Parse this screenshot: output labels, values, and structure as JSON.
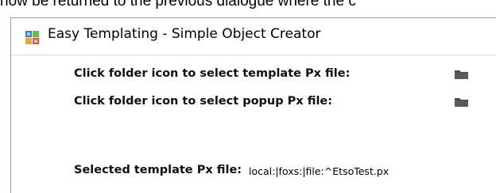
{
  "snippet": {
    "text": "now be returned to the previous dialogue where the c"
  },
  "window": {
    "title": "Easy Templating - Simple Object Creator"
  },
  "form": {
    "template_prompt": "Click folder icon to select template Px file:",
    "popup_prompt": "Click folder icon to select popup Px file:",
    "selected_label": "Selected template Px file:",
    "selected_value": "local:|foxs:|file:^EtsoTest.px"
  },
  "icons": {
    "app": "app-tiles-icon",
    "template_folder": "folder-icon",
    "popup_folder": "folder-icon"
  },
  "colors": {
    "folder": "#4a4a4a",
    "border": "#9a9a9a"
  }
}
